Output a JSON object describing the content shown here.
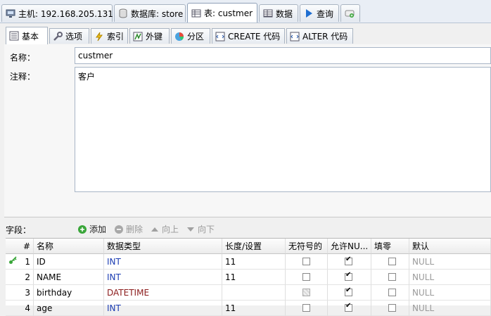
{
  "top_tabs": [
    {
      "label": "主机: 192.168.205.131",
      "icon": "server-icon"
    },
    {
      "label": "数据库: store",
      "icon": "database-icon"
    },
    {
      "label": "表: custmer",
      "icon": "table-icon"
    },
    {
      "label": "数据",
      "icon": "grid-icon"
    },
    {
      "label": "查询",
      "icon": "play-icon"
    },
    {
      "label": "",
      "icon": "new-query-icon"
    }
  ],
  "sub_tabs": [
    {
      "label": "基本",
      "icon": "basic-icon"
    },
    {
      "label": "选项",
      "icon": "wrench-icon"
    },
    {
      "label": "索引",
      "icon": "lightning-icon"
    },
    {
      "label": "外键",
      "icon": "foreign-key-icon"
    },
    {
      "label": "分区",
      "icon": "partition-icon"
    },
    {
      "label": "CREATE 代码",
      "icon": "code-icon"
    },
    {
      "label": "ALTER 代码",
      "icon": "code-icon"
    }
  ],
  "form": {
    "name_label": "名称：",
    "name_value": "custmer",
    "comment_label": "注释：",
    "comment_value": "客户"
  },
  "fields_toolbar": {
    "label": "字段：",
    "add": "添加",
    "delete": "删除",
    "up": "向上",
    "down": "向下"
  },
  "grid": {
    "headers": [
      "#",
      "名称",
      "数据类型",
      "长度/设置",
      "无符号的",
      "允许NU...",
      "填零",
      "默认"
    ],
    "rows": [
      {
        "num": "1",
        "name": "ID",
        "type": "INT",
        "length": "11",
        "unsigned": false,
        "unsigned_disabled": false,
        "nullable": true,
        "zerofill": false,
        "default": "NULL",
        "primary_key": true
      },
      {
        "num": "2",
        "name": "NAME",
        "type": "INT",
        "length": "11",
        "unsigned": false,
        "unsigned_disabled": false,
        "nullable": true,
        "zerofill": false,
        "default": "NULL",
        "primary_key": false
      },
      {
        "num": "3",
        "name": "birthday",
        "type": "DATETIME",
        "length": "",
        "unsigned": false,
        "unsigned_disabled": true,
        "nullable": true,
        "zerofill": false,
        "default": "NULL",
        "primary_key": false
      },
      {
        "num": "4",
        "name": "age",
        "type": "INT",
        "length": "11",
        "unsigned": false,
        "unsigned_disabled": false,
        "nullable": true,
        "zerofill": false,
        "default": "NULL",
        "primary_key": false
      }
    ]
  }
}
